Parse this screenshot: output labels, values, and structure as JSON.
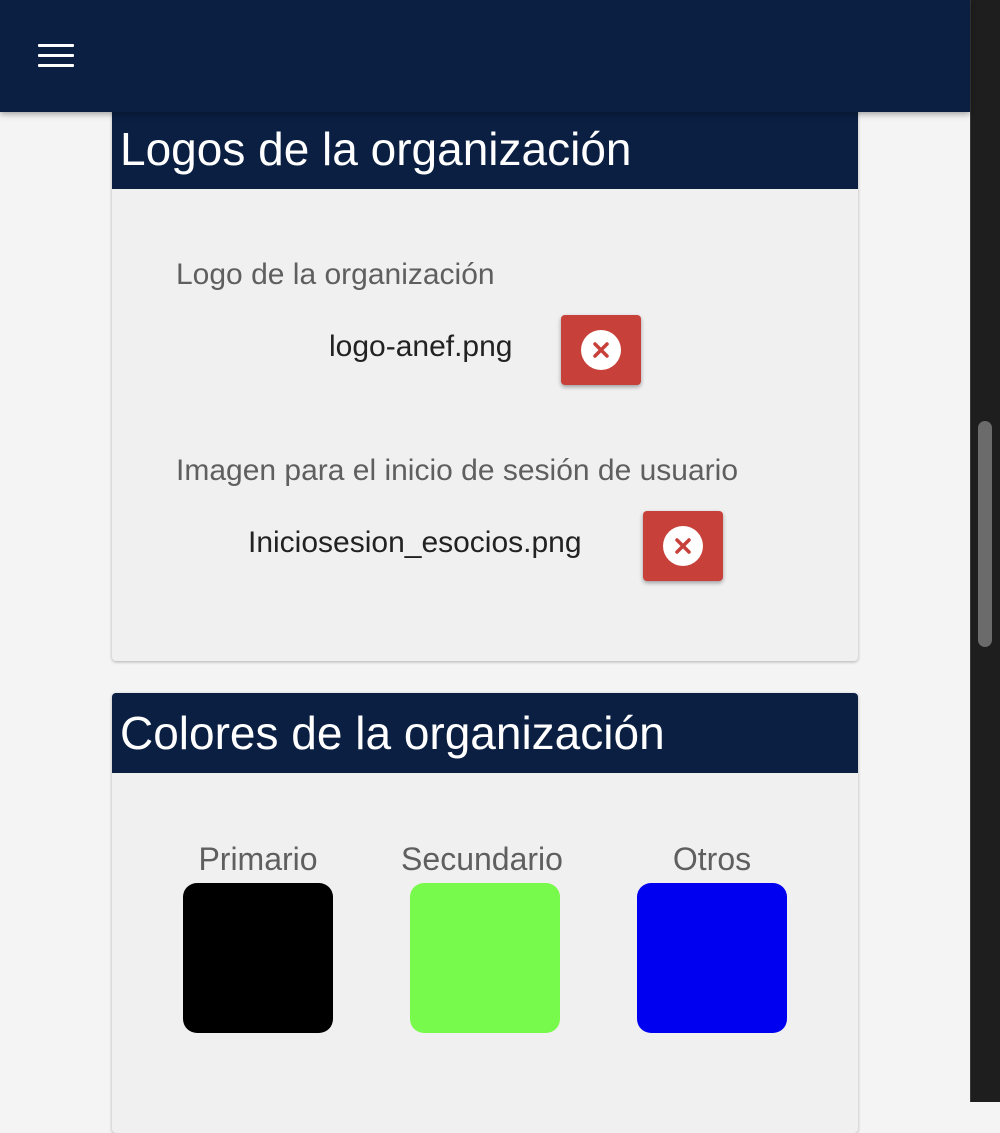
{
  "header": {
    "menu_icon": "hamburger-menu-icon"
  },
  "logos_section": {
    "title": "Logos de la organización",
    "fields": [
      {
        "label": "Logo de la organización",
        "file_name": "logo-anef.png",
        "remove_icon": "close-circle-icon"
      },
      {
        "label": "Imagen para el inicio de sesión de usuario",
        "file_name": "Iniciosesion_esocios.png",
        "remove_icon": "close-circle-icon"
      }
    ]
  },
  "colors_section": {
    "title": "Colores de la organización",
    "swatches": [
      {
        "label": "Primario",
        "color": "#000000"
      },
      {
        "label": "Secundario",
        "color": "#78fa4c"
      },
      {
        "label": "Otros",
        "color": "#0000f0"
      }
    ]
  },
  "theme": {
    "navy": "#0b1f43",
    "danger": "#c8403a"
  }
}
